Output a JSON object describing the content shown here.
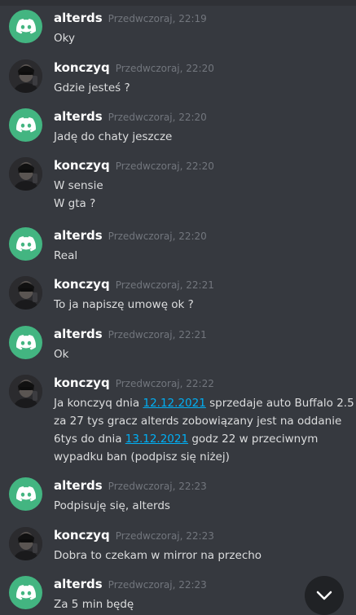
{
  "messages": [
    {
      "author": "alterds",
      "avatar": "discord-logo-icon",
      "timestamp": "Przedwczoraj, 22:19",
      "text": "Oky"
    },
    {
      "author": "konczyq",
      "avatar": "user-photo-avatar",
      "timestamp": "Przedwczoraj, 22:20",
      "text": "Gdzie jesteś ?"
    },
    {
      "author": "alterds",
      "avatar": "discord-logo-icon",
      "timestamp": "Przedwczoraj, 22:20",
      "text": "Jadę do chaty jeszcze"
    },
    {
      "author": "konczyq",
      "avatar": "user-photo-avatar",
      "timestamp": "Przedwczoraj, 22:20",
      "text": "W sensie\nW gta ?"
    },
    {
      "author": "alterds",
      "avatar": "discord-logo-icon",
      "timestamp": "Przedwczoraj, 22:20",
      "text": "Real"
    },
    {
      "author": "konczyq",
      "avatar": "user-photo-avatar",
      "timestamp": "Przedwczoraj, 22:21",
      "text": "To ja napiszę umowę ok ?"
    },
    {
      "author": "alterds",
      "avatar": "discord-logo-icon",
      "timestamp": "Przedwczoraj, 22:21",
      "text": "Ok"
    },
    {
      "author": "konczyq",
      "avatar": "user-photo-avatar",
      "timestamp": "Przedwczoraj, 22:22",
      "text_parts": [
        {
          "t": "Ja konczyq dnia "
        },
        {
          "t": "12.12.2021",
          "link": true
        },
        {
          "t": " sprzedaje auto Buffalo 2.5\nza 27 tys  gracz alterds zobowiązany jest na oddanie\n6tys do dnia "
        },
        {
          "t": "13.12.2021",
          "link": true
        },
        {
          "t": " godz 22 w przeciwnym\nwypadku ban (podpisz się niżej)"
        }
      ]
    },
    {
      "author": "alterds",
      "avatar": "discord-logo-icon",
      "timestamp": "Przedwczoraj, 22:23",
      "text": "Podpisuję się, alterds"
    },
    {
      "author": "konczyq",
      "avatar": "user-photo-avatar",
      "timestamp": "Przedwczoraj, 22:23",
      "text": "Dobra to czekam w mirror na przecho"
    },
    {
      "author": "alterds",
      "avatar": "discord-logo-icon",
      "timestamp": "Przedwczoraj, 22:23",
      "text": "Za 5 min będę"
    }
  ],
  "scroll_button": {
    "icon": "chevron-down-icon"
  },
  "colors": {
    "background": "#36393f",
    "discord_green": "#43b581",
    "link": "#00aff4",
    "timestamp": "#72767d"
  }
}
